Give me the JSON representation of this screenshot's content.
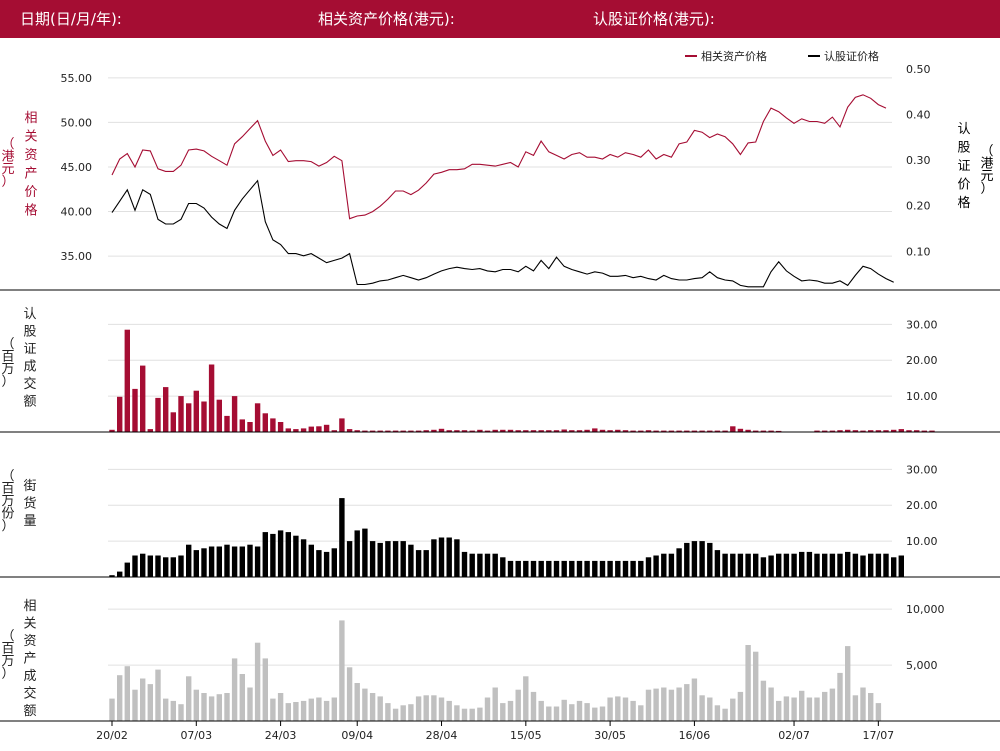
{
  "header": {
    "date_label": "日期(日/月/年):",
    "asset_price_label": "相关资产价格(港元):",
    "warrant_price_label": "认股证价格(港元):"
  },
  "colors": {
    "header_bg": "#a50d33",
    "asset": "#a50d33",
    "warrant": "#000000",
    "asset_turnover": "#c0c0c0",
    "grid": "#e0e0e0"
  },
  "legend": {
    "asset": "相关资产价格",
    "warrant": "认股证价格"
  },
  "chart_data": [
    {
      "type": "line",
      "name": "price-panel",
      "left_axis_label": [
        "相",
        "关",
        "资",
        "产",
        "价",
        "格"
      ],
      "left_axis_unit": [
        "（",
        "港",
        "元",
        "）"
      ],
      "right_axis_label": [
        "认",
        "股",
        "证",
        "价",
        "格"
      ],
      "right_axis_unit": [
        "（",
        "港",
        "元",
        "）"
      ],
      "left_ylim": [
        31.2,
        57.0
      ],
      "left_ticks": [
        "55.00",
        "50.00",
        "45.00",
        "40.00",
        "35.00"
      ],
      "left_tick_values": [
        55,
        50,
        45,
        40,
        35
      ],
      "right_ylim": [
        0.015,
        0.52
      ],
      "right_ticks": [
        "0.50",
        "0.40",
        "0.30",
        "0.20",
        "0.10"
      ],
      "right_tick_values": [
        0.5,
        0.4,
        0.3,
        0.2,
        0.1
      ],
      "series": [
        {
          "name": "相关资产价格",
          "axis": "left",
          "color": "#a50d33",
          "values": [
            44.1,
            45.9,
            46.5,
            45.0,
            46.9,
            46.8,
            44.8,
            44.5,
            44.5,
            45.2,
            46.9,
            47.0,
            46.8,
            46.2,
            45.7,
            45.2,
            47.6,
            48.4,
            49.3,
            50.2,
            47.9,
            46.3,
            46.9,
            45.6,
            45.7,
            45.7,
            45.6,
            45.1,
            45.5,
            46.2,
            45.7,
            39.2,
            39.5,
            39.6,
            40.0,
            40.6,
            41.4,
            42.3,
            42.3,
            41.9,
            42.4,
            43.2,
            44.2,
            44.4,
            44.7,
            44.7,
            44.8,
            45.3,
            45.3,
            45.2,
            45.1,
            45.3,
            45.5,
            45.0,
            46.7,
            46.3,
            47.9,
            46.7,
            46.3,
            45.9,
            46.4,
            46.6,
            46.1,
            46.1,
            45.9,
            46.4,
            46.1,
            46.6,
            46.4,
            46.1,
            46.9,
            45.9,
            46.4,
            46.1,
            47.6,
            47.8,
            49.1,
            48.9,
            48.3,
            48.7,
            48.4,
            47.6,
            46.4,
            47.7,
            47.8,
            50.1,
            51.6,
            51.2,
            50.5,
            49.9,
            50.4,
            50.1,
            50.1,
            49.9,
            50.6,
            49.5,
            51.7,
            52.8,
            53.1,
            52.7,
            52.0,
            51.6
          ]
        },
        {
          "name": "认股证价格",
          "axis": "right",
          "color": "#000000",
          "values": [
            0.185,
            0.21,
            0.235,
            0.19,
            0.235,
            0.225,
            0.17,
            0.16,
            0.16,
            0.17,
            0.205,
            0.205,
            0.195,
            0.175,
            0.16,
            0.15,
            0.19,
            0.215,
            0.235,
            0.255,
            0.165,
            0.125,
            0.115,
            0.095,
            0.095,
            0.09,
            0.095,
            0.085,
            0.075,
            0.08,
            0.085,
            0.095,
            0.027,
            0.027,
            0.03,
            0.035,
            0.037,
            0.042,
            0.047,
            0.042,
            0.037,
            0.042,
            0.05,
            0.057,
            0.062,
            0.065,
            0.062,
            0.06,
            0.062,
            0.057,
            0.055,
            0.06,
            0.06,
            0.055,
            0.067,
            0.057,
            0.08,
            0.062,
            0.087,
            0.067,
            0.06,
            0.055,
            0.05,
            0.055,
            0.052,
            0.045,
            0.045,
            0.047,
            0.042,
            0.045,
            0.04,
            0.037,
            0.047,
            0.04,
            0.037,
            0.037,
            0.04,
            0.042,
            0.055,
            0.042,
            0.037,
            0.035,
            0.025,
            0.022,
            0.022,
            0.022,
            0.055,
            0.077,
            0.057,
            0.045,
            0.035,
            0.037,
            0.035,
            0.03,
            0.03,
            0.035,
            0.025,
            0.047,
            0.067,
            0.062,
            0.05,
            0.04,
            0.032
          ]
        }
      ]
    },
    {
      "type": "bar",
      "name": "warrant-turnover",
      "left_axis_label": [
        "认",
        "股",
        "证",
        "成",
        "交",
        "额"
      ],
      "left_axis_unit": [
        "（",
        "百",
        "万",
        "）"
      ],
      "ylim": [
        0,
        34
      ],
      "ticks": [
        "30.00",
        "20.00",
        "10.00"
      ],
      "tick_values": [
        30,
        20,
        10
      ],
      "color": "#a50d33",
      "values": [
        0.6,
        9.8,
        28.5,
        12.0,
        18.5,
        0.8,
        9.5,
        12.5,
        5.5,
        10.0,
        8.0,
        11.5,
        8.5,
        18.8,
        9.0,
        4.5,
        10.0,
        3.5,
        2.8,
        8.0,
        5.2,
        3.8,
        2.8,
        1.0,
        0.8,
        1.0,
        1.5,
        1.6,
        2.0,
        0.5,
        3.8,
        0.8,
        0.5,
        0.4,
        0.4,
        0.4,
        0.4,
        0.4,
        0.4,
        0.4,
        0.4,
        0.5,
        0.6,
        0.9,
        0.5,
        0.5,
        0.5,
        0.4,
        0.6,
        0.4,
        0.6,
        0.6,
        0.6,
        0.5,
        0.5,
        0.5,
        0.5,
        0.5,
        0.5,
        0.7,
        0.5,
        0.5,
        0.6,
        1.0,
        0.6,
        0.5,
        0.6,
        0.5,
        0.4,
        0.4,
        0.5,
        0.4,
        0.4,
        0.4,
        0.4,
        0.4,
        0.4,
        0.4,
        0.4,
        0.4,
        0.4,
        1.6,
        0.9,
        0.6,
        0.4,
        0.4,
        0.4,
        0.3,
        0.0,
        0.0,
        0.0,
        0.0,
        0.4,
        0.4,
        0.4,
        0.5,
        0.6,
        0.5,
        0.4,
        0.5,
        0.5,
        0.5,
        0.6,
        0.8,
        0.5,
        0.5,
        0.4,
        0.4
      ]
    },
    {
      "type": "bar",
      "name": "outstanding-warrants",
      "left_axis_label": [
        "街",
        "货",
        "量"
      ],
      "left_axis_unit": [
        "（",
        "百",
        "万",
        "份",
        "）"
      ],
      "ylim": [
        0,
        34
      ],
      "ticks": [
        "30.00",
        "20.00",
        "10.00"
      ],
      "tick_values": [
        30,
        20,
        10
      ],
      "color": "#000000",
      "values": [
        0.5,
        1.5,
        4.0,
        6.0,
        6.5,
        6.0,
        6.0,
        5.5,
        5.5,
        6.0,
        9.0,
        7.5,
        8.0,
        8.5,
        8.5,
        9.0,
        8.5,
        8.5,
        9.0,
        8.5,
        12.5,
        12.0,
        13.0,
        12.5,
        11.5,
        10.5,
        9.0,
        7.5,
        7.0,
        8.0,
        22.0,
        10.0,
        13.0,
        13.5,
        10.0,
        9.5,
        10.0,
        10.0,
        10.0,
        9.0,
        7.5,
        7.5,
        10.5,
        11.0,
        11.0,
        10.5,
        7.0,
        6.5,
        6.5,
        6.5,
        6.5,
        5.5,
        4.5,
        4.5,
        4.5,
        4.5,
        4.5,
        4.5,
        4.5,
        4.5,
        4.5,
        4.5,
        4.5,
        4.5,
        4.5,
        4.5,
        4.5,
        4.5,
        4.5,
        4.5,
        5.5,
        6.0,
        6.5,
        6.5,
        8.0,
        9.5,
        10.0,
        10.0,
        9.5,
        7.5,
        6.5,
        6.5,
        6.5,
        6.5,
        6.5,
        5.5,
        6.0,
        6.5,
        6.5,
        6.5,
        7.0,
        7.0,
        6.5,
        6.5,
        6.5,
        6.5,
        7.0,
        6.5,
        6.0,
        6.5,
        6.5,
        6.5,
        5.5,
        6.0
      ]
    },
    {
      "type": "bar",
      "name": "asset-turnover",
      "left_axis_label": [
        "相",
        "关",
        "资",
        "产",
        "成",
        "交",
        "额"
      ],
      "left_axis_unit": [
        "（",
        "百",
        "万",
        "）"
      ],
      "ylim": [
        0,
        11000
      ],
      "ticks": [
        "10,000",
        "5,000"
      ],
      "tick_values": [
        10000,
        5000
      ],
      "color": "#c0c0c0",
      "values": [
        2000,
        4100,
        4900,
        2800,
        3800,
        3300,
        4600,
        2000,
        1800,
        1500,
        4000,
        2800,
        2500,
        2200,
        2400,
        2500,
        5600,
        4200,
        3000,
        7000,
        5600,
        2000,
        2500,
        1600,
        1700,
        1800,
        2000,
        2100,
        1800,
        2100,
        9000,
        4800,
        3400,
        2900,
        2500,
        2200,
        1600,
        1100,
        1400,
        1500,
        2200,
        2300,
        2300,
        2100,
        1800,
        1400,
        1100,
        1100,
        1200,
        2100,
        3000,
        1600,
        1800,
        2800,
        4000,
        2600,
        1800,
        1300,
        1300,
        1900,
        1500,
        1800,
        1600,
        1200,
        1300,
        2100,
        2200,
        2100,
        1800,
        1400,
        2800,
        2900,
        3000,
        2800,
        3000,
        3300,
        3800,
        2300,
        2100,
        1400,
        1100,
        2000,
        2600,
        6800,
        6200,
        3600,
        3000,
        1800,
        2200,
        2100,
        2700,
        2100,
        2100,
        2600,
        2900,
        4300,
        6700,
        2300,
        3000,
        2500,
        1600
      ]
    }
  ],
  "x_ticks": [
    {
      "label": "20/02",
      "index": 0
    },
    {
      "label": "07/03",
      "index": 11
    },
    {
      "label": "24/03",
      "index": 22
    },
    {
      "label": "09/04",
      "index": 32
    },
    {
      "label": "28/04",
      "index": 43
    },
    {
      "label": "15/05",
      "index": 54
    },
    {
      "label": "30/05",
      "index": 65
    },
    {
      "label": "16/06",
      "index": 76
    },
    {
      "label": "02/07",
      "index": 89
    },
    {
      "label": "17/07",
      "index": 100
    }
  ]
}
